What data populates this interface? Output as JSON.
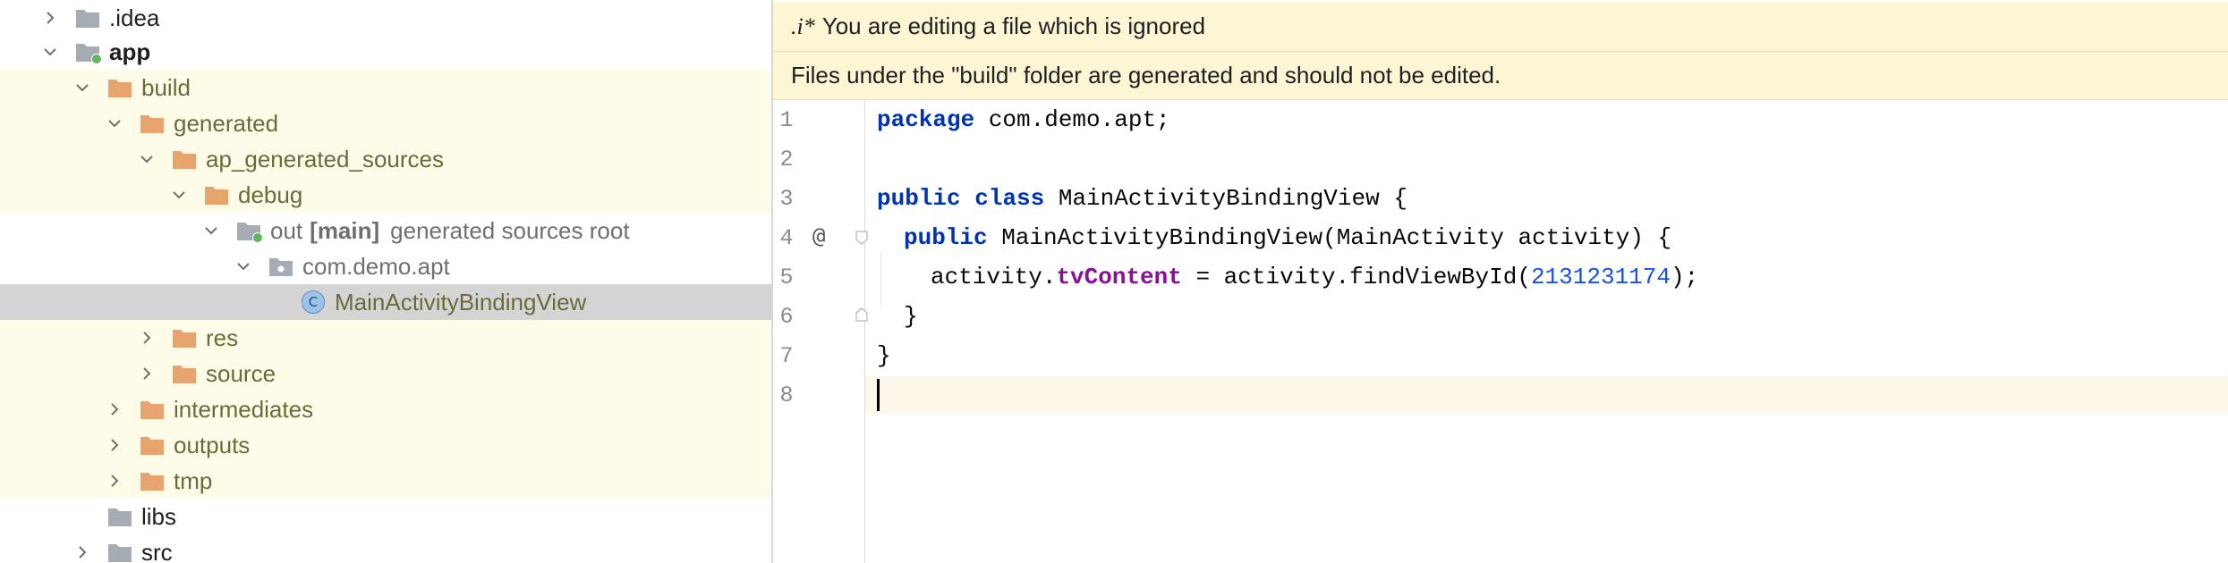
{
  "project_tree": {
    "items": [
      {
        "label": ".idea",
        "expanded": false,
        "kind": "folder-grey"
      },
      {
        "label": "app",
        "expanded": true,
        "kind": "module"
      },
      {
        "label": "build",
        "expanded": true,
        "kind": "folder-orange"
      },
      {
        "label": "generated",
        "expanded": true,
        "kind": "folder-orange"
      },
      {
        "label": "ap_generated_sources",
        "expanded": true,
        "kind": "folder-orange"
      },
      {
        "label": "debug",
        "expanded": true,
        "kind": "folder-orange"
      },
      {
        "label": "out",
        "tag": "[main]",
        "note": "generated sources root",
        "expanded": true,
        "kind": "source-root"
      },
      {
        "label": "com.demo.apt",
        "expanded": true,
        "kind": "package"
      },
      {
        "label": "MainActivityBindingView",
        "kind": "class",
        "icon_letter": "C"
      },
      {
        "label": "res",
        "expanded": false,
        "kind": "folder-orange"
      },
      {
        "label": "source",
        "expanded": false,
        "kind": "folder-orange"
      },
      {
        "label": "intermediates",
        "expanded": false,
        "kind": "folder-orange"
      },
      {
        "label": "outputs",
        "expanded": false,
        "kind": "folder-orange"
      },
      {
        "label": "tmp",
        "expanded": false,
        "kind": "folder-orange"
      },
      {
        "label": "libs",
        "kind": "folder-grey"
      },
      {
        "label": "src",
        "expanded": false,
        "kind": "folder-grey"
      }
    ]
  },
  "editor": {
    "banner_ignored": {
      "icon_text": ".i*",
      "text": "You are editing a file which is ignored"
    },
    "banner_generated": {
      "text": "Files under the \"build\" folder are generated and should not be edited."
    },
    "line_numbers": [
      "1",
      "2",
      "3",
      "4",
      "5",
      "6",
      "7",
      "8"
    ],
    "gutter_marker": "@",
    "code": {
      "l1_kw": "package",
      "l1_rest": " com.demo.apt;",
      "l3_kw1": "public",
      "l3_kw2": "class",
      "l3_rest": " MainActivityBindingView {",
      "l4_kw": "public",
      "l4_rest": " MainActivityBindingView(MainActivity activity) {",
      "l5_a": "activity.",
      "l5_field": "tvContent",
      "l5_b": " = activity.findViewById(",
      "l5_num": "2131231174",
      "l5_c": ");",
      "l6": "}",
      "l7": "}"
    }
  },
  "colors": {
    "generated_bg": "#fefce9",
    "selected_bg": "#d4d4d4",
    "banner_bg": "#fdf6d4",
    "keyword": "#0033b3",
    "field": "#871094",
    "number": "#1750eb"
  }
}
